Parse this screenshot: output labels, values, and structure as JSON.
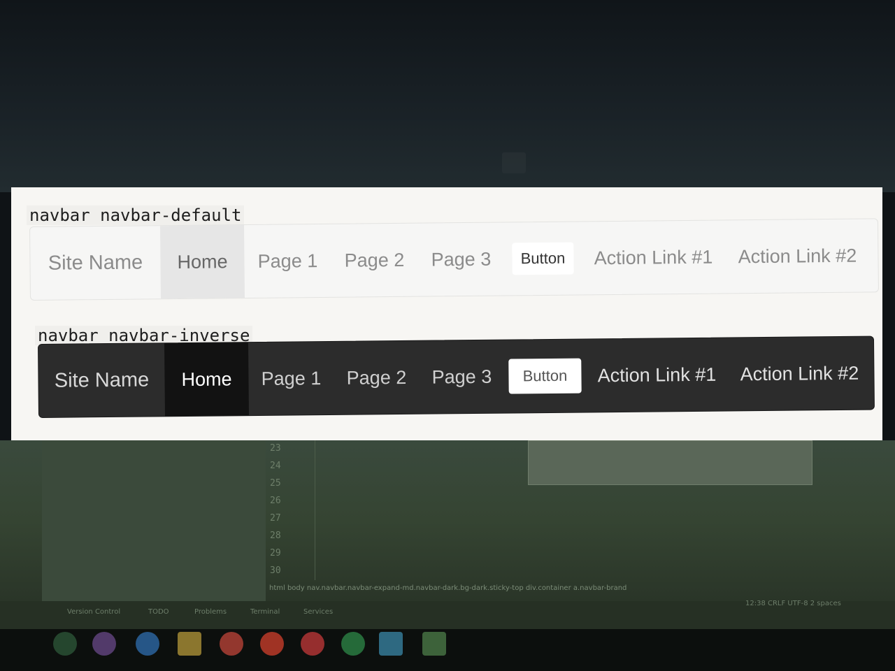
{
  "labels": {
    "default_class": "navbar navbar-default",
    "inverse_class": "navbar navbar-inverse"
  },
  "navbar_default": {
    "brand": "Site Name",
    "items": [
      {
        "label": "Home",
        "active": true
      },
      {
        "label": "Page 1",
        "active": false
      },
      {
        "label": "Page 2",
        "active": false
      },
      {
        "label": "Page 3",
        "active": false
      }
    ],
    "button": "Button",
    "actions": [
      "Action Link #1",
      "Action Link #2"
    ]
  },
  "navbar_inverse": {
    "brand": "Site Name",
    "items": [
      {
        "label": "Home",
        "active": true
      },
      {
        "label": "Page 1",
        "active": false
      },
      {
        "label": "Page 2",
        "active": false
      },
      {
        "label": "Page 3",
        "active": false
      }
    ],
    "button": "Button",
    "actions": [
      "Action Link #1",
      "Action Link #2"
    ]
  },
  "ide": {
    "line_numbers": [
      "23",
      "24",
      "25",
      "26",
      "27",
      "28",
      "29",
      "30"
    ],
    "breadcrumb": "html   body   nav.navbar.navbar-expand-md.navbar-dark.bg-dark.sticky-top   div.container   a.navbar-brand",
    "status_left": [
      "Version Control",
      "TODO",
      "Problems",
      "Terminal",
      "Services"
    ],
    "status_right": "12:38   CRLF   UTF-8   2 spaces"
  },
  "colors": {
    "inverse_bg": "#2c2c2c",
    "inverse_active": "#121212",
    "default_bg": "#f6f6f5",
    "default_active": "#e6e6e6"
  }
}
